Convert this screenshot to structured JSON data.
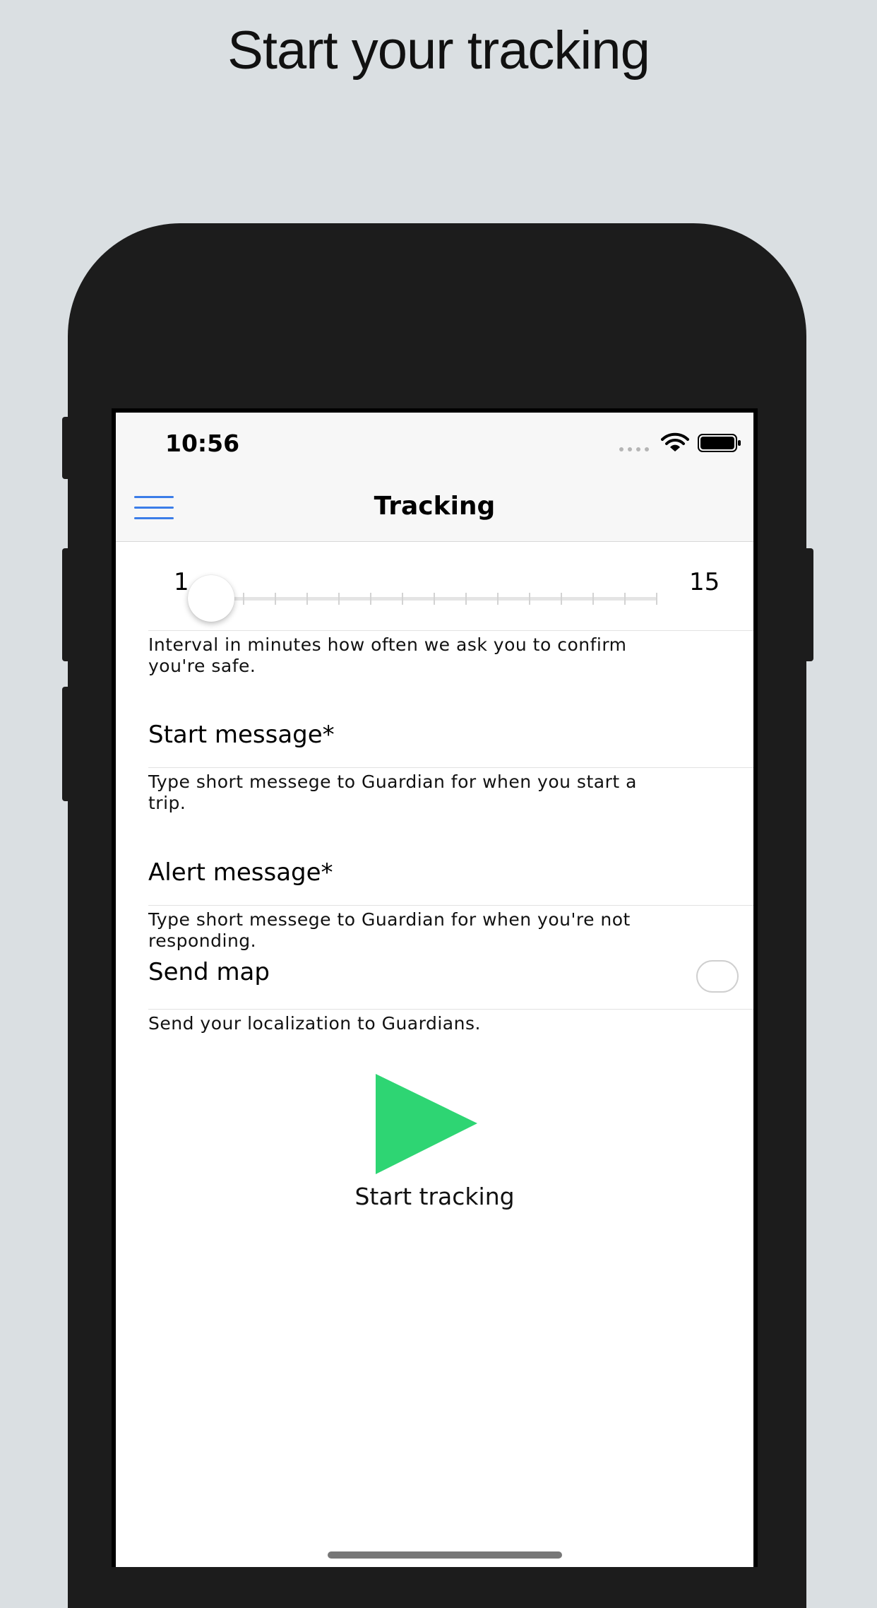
{
  "promo": {
    "title": "Start your tracking"
  },
  "status_bar": {
    "time": "10:56"
  },
  "nav": {
    "title": "Tracking",
    "menu_icon": "hamburger-menu-icon"
  },
  "interval_slider": {
    "min_label": "1",
    "max_label": "15",
    "min": 1,
    "max": 15,
    "value": 1,
    "hint": "Interval in minutes how often we ask you to confirm you're safe."
  },
  "start_message": {
    "label": "Start message*",
    "value": "",
    "hint": "Type short messege to Guardian for when you start a trip."
  },
  "alert_message": {
    "label": "Alert message*",
    "value": "",
    "hint": "Type short messege to Guardian for when you're not responding."
  },
  "send_map": {
    "label": "Send map",
    "checked": false,
    "hint": "Send your localization to Guardians."
  },
  "start_button": {
    "label": "Start tracking",
    "icon": "play-icon",
    "color": "#2ed573"
  },
  "colors": {
    "accent": "#3b7de8",
    "play": "#2ed573"
  }
}
